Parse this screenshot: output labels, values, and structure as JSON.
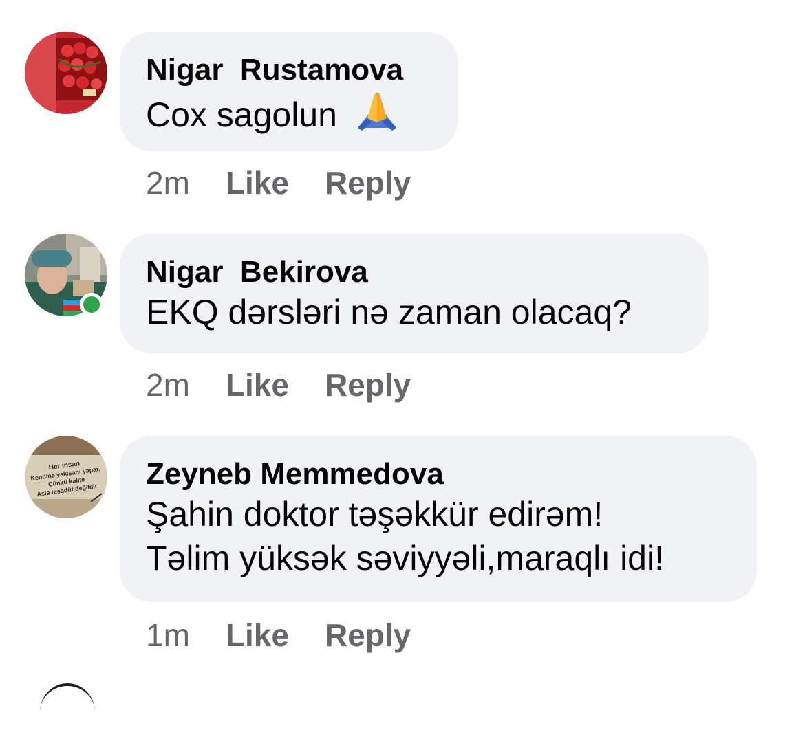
{
  "comments": [
    {
      "author": "Nigar  Rustamova",
      "text_lines": [
        "Cox sagolun"
      ],
      "emoji": "folded-hands-emoji",
      "time": "2m",
      "like_label": "Like",
      "reply_label": "Reply",
      "online": false
    },
    {
      "author": "Nigar  Bekirova",
      "text_lines": [
        "EKQ dərsləri nə zaman olacaq?"
      ],
      "time": "2m",
      "like_label": "Like",
      "reply_label": "Reply",
      "online": true
    },
    {
      "author": "Zeyneb Memmedova",
      "text_lines": [
        "Şahin doktor təşəkkür edirəm!",
        "Təlim yüksək səviyyəli,maraqlı idi!"
      ],
      "time": "1m",
      "like_label": "Like",
      "reply_label": "Reply",
      "online": false,
      "avatar_text": [
        "Her insan",
        "Kendine yakışanı yapar.",
        "Çünkü kalite",
        "Asla tesadüf değildir."
      ]
    }
  ],
  "colors": {
    "bubble_bg": "#f0f2f5",
    "secondary_text": "#65676b",
    "online_green": "#31a24c"
  }
}
